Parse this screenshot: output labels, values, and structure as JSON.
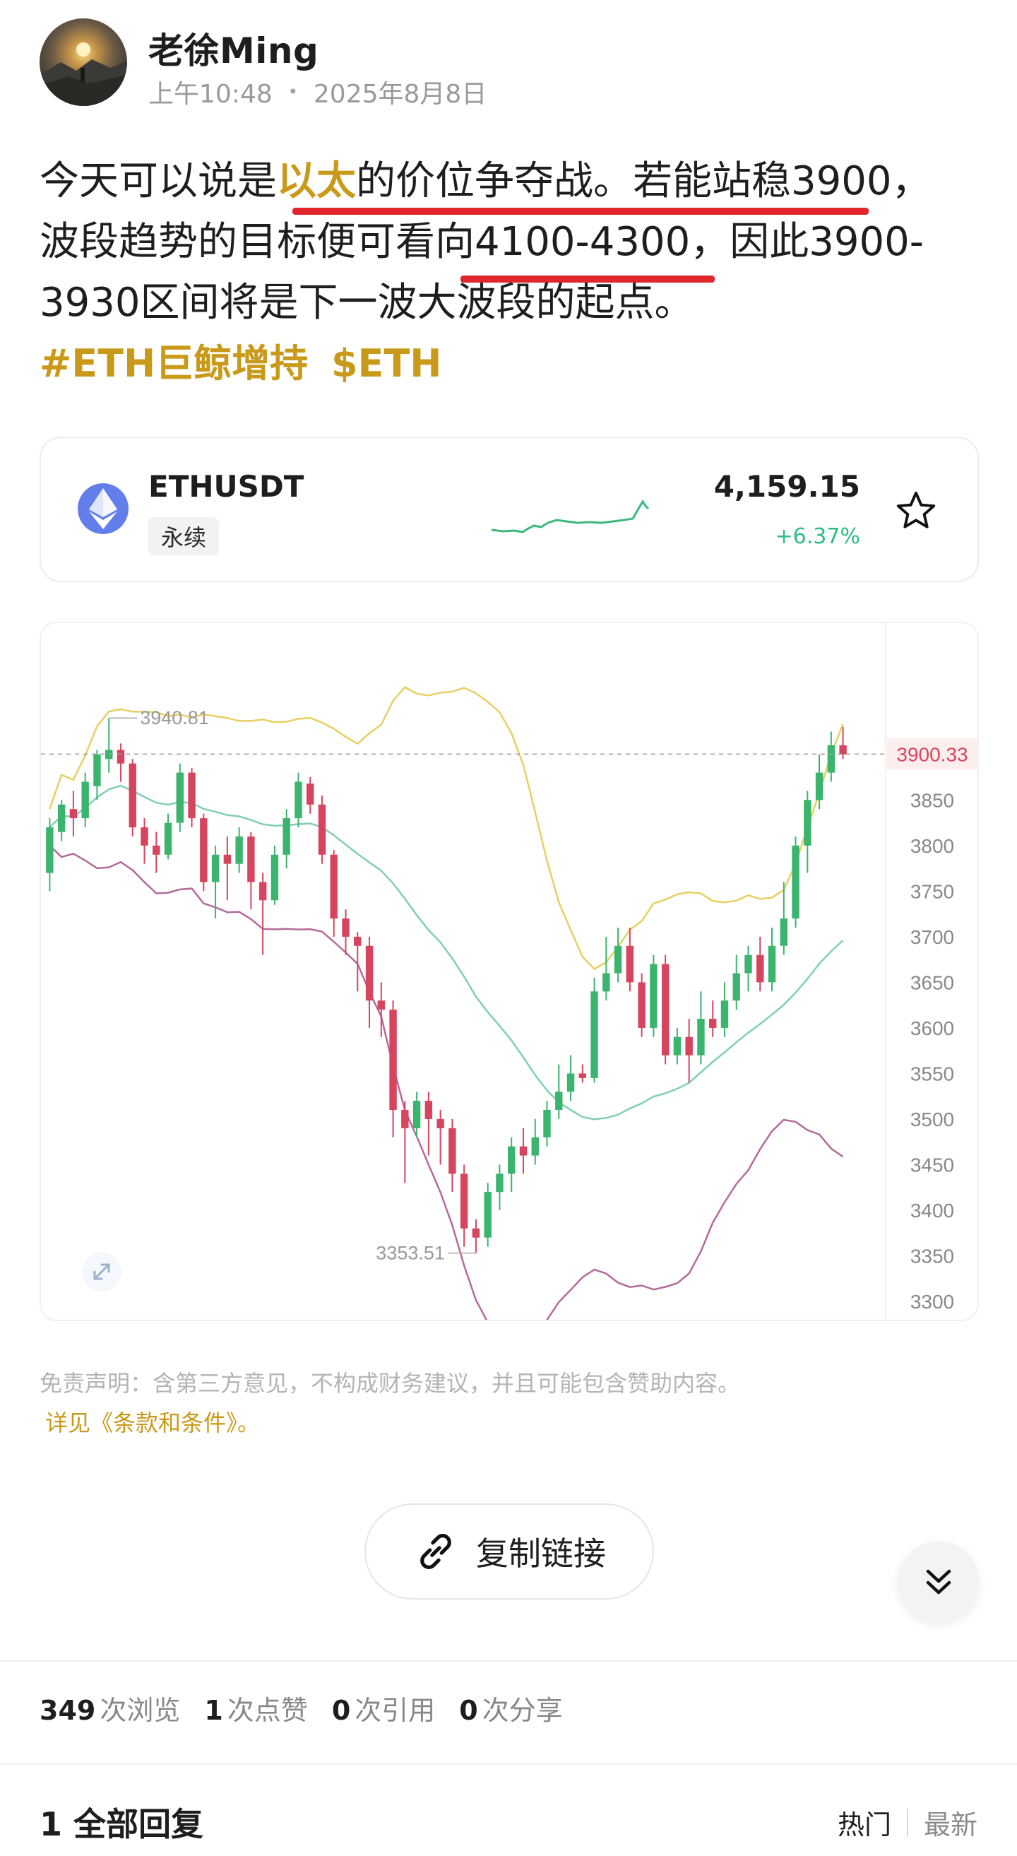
{
  "author": {
    "name": "老徐Ming",
    "time": "上午10:48",
    "date": "2025年8月8日"
  },
  "post": {
    "line1_a": "今天可以说是",
    "line1_hl": "以太",
    "line1_b": "的价位争夺战。若能站稳3900，",
    "line2": "波段趋势的目标便可看向4100-4300，因此3900-",
    "line3": "3930区间将是下一波大波段的起点。",
    "tag1": "#ETH巨鲸增持",
    "tag2": "$ETH",
    "underline_color": "#e0262c",
    "accent_color": "#c99a1a"
  },
  "ticker": {
    "pair": "ETHUSDT",
    "badge": "永续",
    "price": "4,159.15",
    "change": "+6.37%",
    "change_color": "#2ebd85",
    "icon": "ethereum-icon",
    "favorite_icon": "star-icon"
  },
  "chart_data": {
    "type": "candlestick",
    "indicators": [
      "bollinger-upper",
      "bollinger-middle",
      "bollinger-lower"
    ],
    "y_ticks": [
      "3850",
      "3800",
      "3750",
      "3700",
      "3650",
      "3600",
      "3550",
      "3500",
      "3450",
      "3400",
      "3350",
      "3300"
    ],
    "ylim": [
      3300,
      3920
    ],
    "current_price_label": "3900.33",
    "high_label": "3940.81",
    "low_label": "3353.51",
    "up_color": "#3bb46e",
    "down_color": "#d6455d",
    "upper_band_color": "#e8cf62",
    "middle_band_color": "#7fcfb4",
    "lower_band_color": "#b36a9a",
    "candles": [
      [
        3770,
        3820,
        3750,
        3830
      ],
      [
        3815,
        3845,
        3805,
        3850
      ],
      [
        3840,
        3830,
        3810,
        3860
      ],
      [
        3830,
        3870,
        3820,
        3880
      ],
      [
        3865,
        3900,
        3850,
        3905
      ],
      [
        3895,
        3905,
        3880,
        3940
      ],
      [
        3905,
        3890,
        3870,
        3912
      ],
      [
        3890,
        3820,
        3810,
        3895
      ],
      [
        3820,
        3800,
        3780,
        3830
      ],
      [
        3800,
        3790,
        3770,
        3815
      ],
      [
        3790,
        3825,
        3785,
        3835
      ],
      [
        3825,
        3880,
        3815,
        3890
      ],
      [
        3880,
        3830,
        3820,
        3885
      ],
      [
        3830,
        3760,
        3750,
        3835
      ],
      [
        3760,
        3790,
        3720,
        3800
      ],
      [
        3790,
        3780,
        3740,
        3810
      ],
      [
        3780,
        3810,
        3770,
        3820
      ],
      [
        3810,
        3760,
        3730,
        3815
      ],
      [
        3760,
        3740,
        3680,
        3770
      ],
      [
        3740,
        3790,
        3735,
        3800
      ],
      [
        3790,
        3830,
        3775,
        3840
      ],
      [
        3830,
        3870,
        3820,
        3880
      ],
      [
        3868,
        3845,
        3835,
        3875
      ],
      [
        3845,
        3790,
        3780,
        3855
      ],
      [
        3790,
        3720,
        3700,
        3795
      ],
      [
        3720,
        3700,
        3680,
        3730
      ],
      [
        3700,
        3690,
        3640,
        3705
      ],
      [
        3690,
        3630,
        3600,
        3700
      ],
      [
        3630,
        3620,
        3590,
        3650
      ],
      [
        3620,
        3510,
        3480,
        3630
      ],
      [
        3510,
        3490,
        3430,
        3520
      ],
      [
        3490,
        3520,
        3480,
        3530
      ],
      [
        3520,
        3500,
        3460,
        3530
      ],
      [
        3500,
        3490,
        3450,
        3510
      ],
      [
        3490,
        3440,
        3420,
        3500
      ],
      [
        3440,
        3380,
        3360,
        3450
      ],
      [
        3380,
        3370,
        3353,
        3390
      ],
      [
        3370,
        3420,
        3360,
        3430
      ],
      [
        3420,
        3440,
        3400,
        3450
      ],
      [
        3440,
        3470,
        3420,
        3480
      ],
      [
        3470,
        3460,
        3440,
        3490
      ],
      [
        3460,
        3480,
        3450,
        3500
      ],
      [
        3480,
        3510,
        3470,
        3520
      ],
      [
        3510,
        3530,
        3500,
        3560
      ],
      [
        3530,
        3550,
        3520,
        3570
      ],
      [
        3550,
        3545,
        3540,
        3560
      ],
      [
        3545,
        3640,
        3540,
        3655
      ],
      [
        3640,
        3660,
        3630,
        3700
      ],
      [
        3660,
        3690,
        3650,
        3710
      ],
      [
        3690,
        3650,
        3640,
        3710
      ],
      [
        3650,
        3600,
        3590,
        3660
      ],
      [
        3600,
        3670,
        3590,
        3680
      ],
      [
        3670,
        3570,
        3560,
        3680
      ],
      [
        3570,
        3590,
        3560,
        3600
      ],
      [
        3590,
        3570,
        3540,
        3610
      ],
      [
        3570,
        3610,
        3560,
        3640
      ],
      [
        3610,
        3600,
        3590,
        3630
      ],
      [
        3600,
        3630,
        3590,
        3650
      ],
      [
        3630,
        3660,
        3620,
        3680
      ],
      [
        3660,
        3680,
        3640,
        3690
      ],
      [
        3680,
        3650,
        3640,
        3700
      ],
      [
        3650,
        3690,
        3640,
        3710
      ],
      [
        3690,
        3720,
        3680,
        3760
      ],
      [
        3720,
        3800,
        3710,
        3810
      ],
      [
        3800,
        3850,
        3770,
        3860
      ],
      [
        3850,
        3880,
        3840,
        3900
      ],
      [
        3880,
        3910,
        3870,
        3925
      ],
      [
        3910,
        3900,
        3895,
        3930
      ]
    ]
  },
  "disclaimer": {
    "text": "免责声明：含第三方意见，不构成财务建议，并且可能包含赞助内容。",
    "link": "详见《条款和条件》。"
  },
  "actions": {
    "copy_link": "复制链接"
  },
  "stats": {
    "views_num": "349",
    "views_label": "次浏览",
    "likes_num": "1",
    "likes_label": "次点赞",
    "quotes_num": "0",
    "quotes_label": "次引用",
    "shares_num": "0",
    "shares_label": "次分享"
  },
  "replies": {
    "title": "1 全部回复",
    "sort_hot": "热门",
    "sort_new": "最新"
  }
}
